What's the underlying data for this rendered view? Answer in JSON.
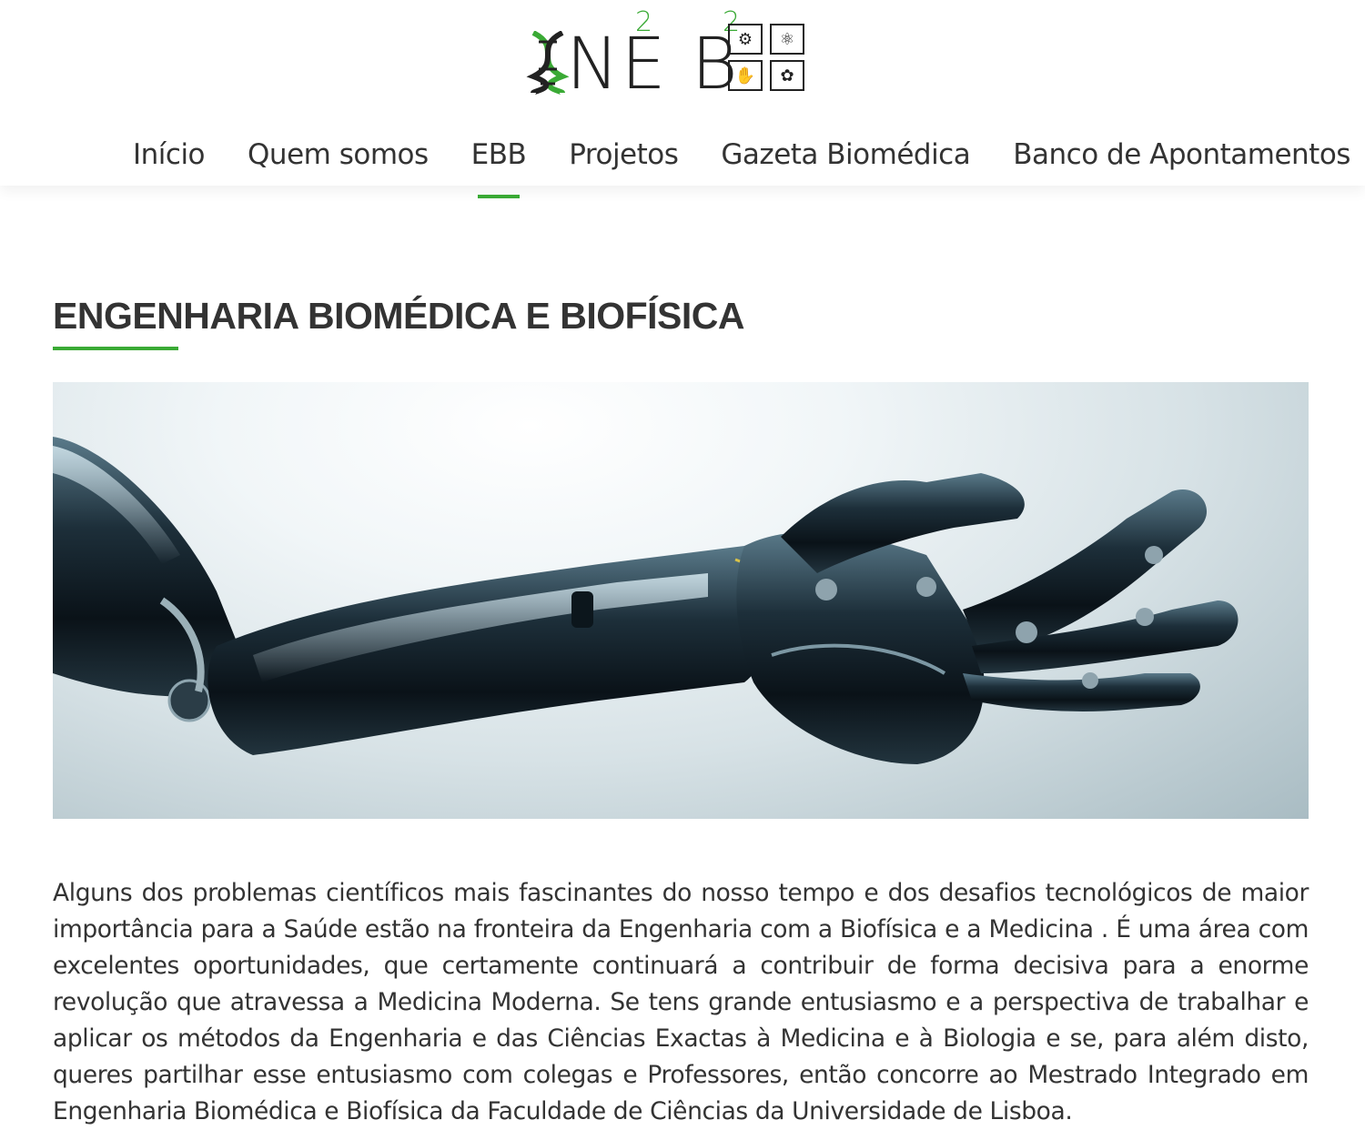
{
  "header": {
    "logo": {
      "text": "NE2B2",
      "letters": [
        "N",
        "E",
        "B"
      ],
      "superscripts": [
        "2",
        "2"
      ],
      "grid_icons": [
        "gears-icon",
        "atom-icon",
        "hand-icon",
        "brain-icon"
      ]
    },
    "nav": [
      {
        "label": "Início",
        "active": false
      },
      {
        "label": "Quem somos",
        "active": false
      },
      {
        "label": "EBB",
        "active": true
      },
      {
        "label": "Projetos",
        "active": false
      },
      {
        "label": "Gazeta Biomédica",
        "active": false
      },
      {
        "label": "Banco de Apontamentos",
        "active": false
      }
    ]
  },
  "main": {
    "title": "ENGENHARIA BIOMÉDICA E BIOFÍSICA",
    "hero_image": "robotic-arm-image",
    "paragraph": "Alguns dos problemas científicos mais fascinantes do nosso tempo e dos desafios tecnológicos de maior importância para a Saúde estão na fronteira da Engenharia com a Biofísica e a Medicina . É uma área com excelentes oportunidades, que certamente continuará a contribuir de forma decisiva para a enorme revolução que atravessa a Medicina Moderna. Se tens grande entusiasmo e a perspectiva de trabalhar e aplicar os métodos da Engenharia e das Ciências Exactas à Medicina e à Biologia e se, para além disto, queres partilhar esse entusiasmo com colegas e Professores, então concorre ao Mestrado Integrado em Engenharia Biomédica e Biofísica da Faculdade de Ciências da Universidade de Lisboa."
  },
  "colors": {
    "accent": "#3aaa35",
    "text": "#333333",
    "background": "#ffffff"
  }
}
